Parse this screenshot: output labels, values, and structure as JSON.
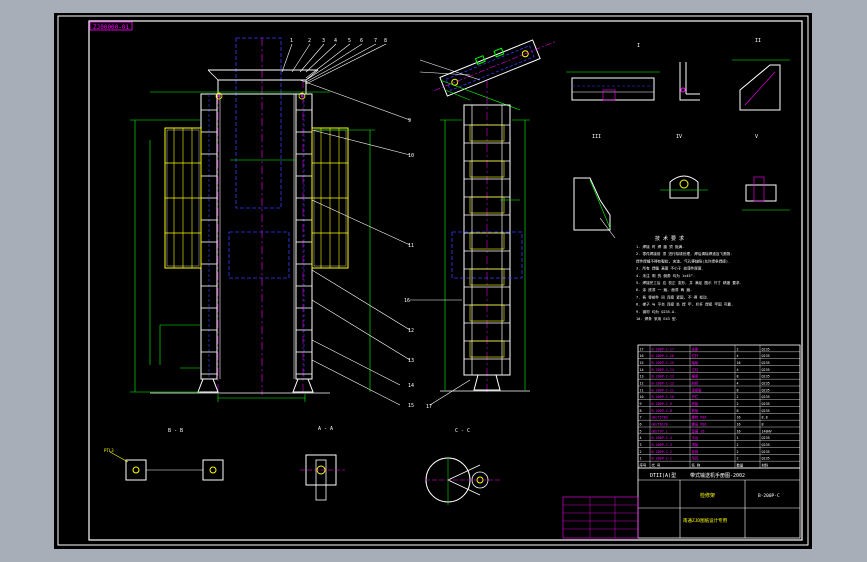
{
  "drawing": {
    "top_label": "ZJ00000-01",
    "title_block": {
      "title_left": "DTII(A)型",
      "title_main": "带式输送机手册图-2002",
      "product_name": "检修架",
      "drawing_no": "B-200P-C",
      "company_line": "南通ZJD图纸设计专用"
    }
  },
  "views": {
    "section_b": "B - B",
    "section_a": "A - A",
    "section_c": "C - C",
    "detail_1": "I",
    "detail_2": "II",
    "detail_3": "III",
    "detail_4": "IV",
    "detail_5": "V"
  },
  "notes": {
    "heading": "技 术 要 求",
    "lines": [
      "1. 焊接 时 焊 缝 须 饱满.",
      "2. 零件焊接前 须 进行除锈处理, 焊后清除焊渣及飞溅物.",
      "   焊件焊缝不得有裂纹, 夹渣, 气孔等缺陷(允许焊条焊接).",
      "3. 所有 焊缝 高度 不小于 较薄件厚度.",
      "4. 未注 明 的 倒角 均为 1x45°.",
      "5. 焊接完工后 应 校正 变形, 并 满足 图示 尺寸 精度 要求.",
      "6. 涂 底漆 一 遍, 面漆 两 遍.",
      "7. 各 零部件 间 连接 紧固, 不 得 松动.",
      "8. 梯子 与 平台 连接 处 焊 牢, 栏杆 焊接 牢固 可靠.",
      "9. 钢材 均为 Q235-A.",
      "10. 焊条 采用 E43 型."
    ]
  },
  "callouts": [
    "1",
    "2",
    "3",
    "4",
    "5",
    "6",
    "7",
    "8",
    "9",
    "10",
    "11",
    "12",
    "13",
    "14",
    "15",
    "16",
    "17"
  ],
  "parts_table": {
    "rows": [
      [
        "17",
        "B-200P-C-17",
        "支座",
        "2",
        "Q235"
      ],
      [
        "16",
        "B-200P-C-16",
        "栏杆",
        "4",
        "Q235"
      ],
      [
        "15",
        "B-200P-C-15",
        "踏板",
        "16",
        "Q235"
      ],
      [
        "14",
        "B-200P-C-14",
        "立柱",
        "4",
        "Q235"
      ],
      [
        "13",
        "B-200P-C-13",
        "横梁",
        "8",
        "Q235"
      ],
      [
        "12",
        "B-200P-C-12",
        "斜撑",
        "4",
        "Q235"
      ],
      [
        "11",
        "B-200P-C-11",
        "连接板",
        "8",
        "Q235"
      ],
      [
        "10",
        "B-200P-C-10",
        "护栏",
        "2",
        "Q235"
      ],
      [
        "9",
        "B-200P-C-9",
        "底板",
        "2",
        "Q235"
      ],
      [
        "8",
        "B-200P-C-8",
        "筋板",
        "8",
        "Q235"
      ],
      [
        "7",
        "GB/T5783",
        "螺栓 M16",
        "16",
        "8.8"
      ],
      [
        "6",
        "GB/T6170",
        "螺母 M16",
        "16",
        "8"
      ],
      [
        "5",
        "GB/T97.1",
        "垫圈 16",
        "16",
        "140HV"
      ],
      [
        "4",
        "B-200P-C-4",
        "平台",
        "1",
        "Q235"
      ],
      [
        "3",
        "B-200P-C-3",
        "顶板",
        "2",
        "Q235"
      ],
      [
        "2",
        "B-200P-C-2",
        "挂钩",
        "2",
        "Q235"
      ],
      [
        "1",
        "B-200P-C-1",
        "吊耳",
        "2",
        "Q235"
      ]
    ],
    "header": [
      "序号",
      "代 号",
      "名 称",
      "数量",
      "材料"
    ]
  },
  "colors": {
    "frame": "#ffffff",
    "yellow": "#ffff00",
    "green": "#00ff00",
    "cyan": "#00ffff",
    "blue": "#3a3aff",
    "magenta": "#ff00ff",
    "white": "#ffffff",
    "red": "#ff3030"
  }
}
